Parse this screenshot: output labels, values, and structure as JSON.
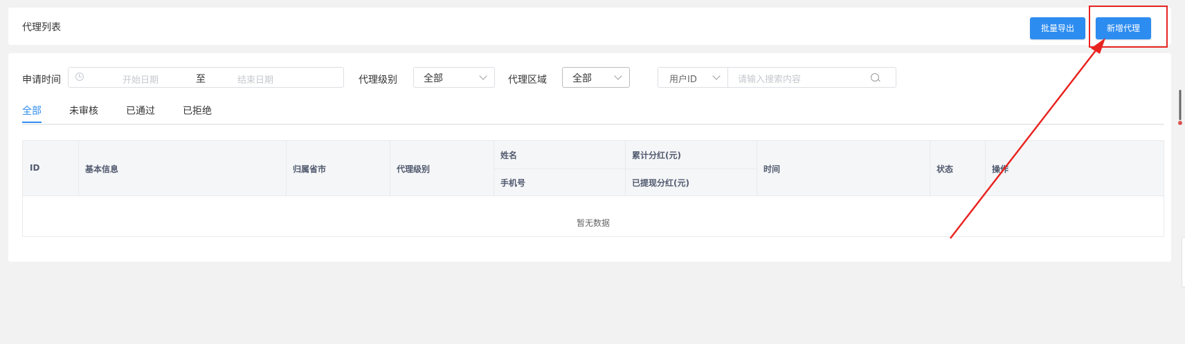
{
  "header": {
    "title": "代理列表",
    "export_button": "批量导出",
    "add_button": "新增代理"
  },
  "filters": {
    "apply_time_label": "申请时间",
    "start_date_placeholder": "开始日期",
    "range_separator": "至",
    "end_date_placeholder": "结束日期",
    "level_label": "代理级别",
    "level_value": "全部",
    "region_label": "代理区域",
    "region_value": "全部",
    "search_type": "用户ID",
    "search_placeholder": "请输入搜索内容"
  },
  "tabs": [
    {
      "label": "全部",
      "active": true
    },
    {
      "label": "未审核",
      "active": false
    },
    {
      "label": "已通过",
      "active": false
    },
    {
      "label": "已拒绝",
      "active": false
    }
  ],
  "table": {
    "columns": {
      "id": "ID",
      "basic_info": "基本信息",
      "province_city": "归属省市",
      "agent_level": "代理级别",
      "name": "姓名",
      "phone": "手机号",
      "total_dividend": "累计分红(元)",
      "withdrawn_dividend": "已提现分红(元)",
      "time": "时间",
      "status": "状态",
      "actions": "操作"
    },
    "empty_text": "暂无数据"
  },
  "colors": {
    "primary": "#2d8cf0",
    "annotation": "#e8231f"
  }
}
